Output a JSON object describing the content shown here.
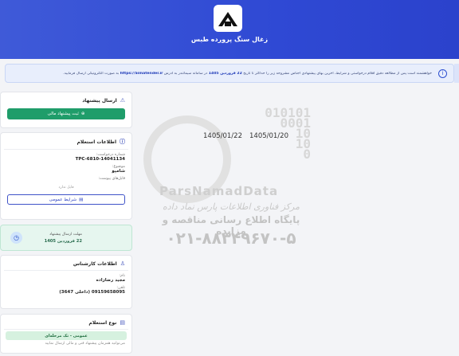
{
  "header": {
    "brand": "زغال سنگ پرورده طبس"
  },
  "notice": {
    "prefix": "خواهشمند است پس از مطالعه دقیق اقلام درخواستی و شرایط، آخرین بهای پیشنهادی اجناس مشروحه زیر را حداکثر تا تاریخ",
    "deadline": "22 فروردین 1405",
    "middle": "در سامانه سیماتندر به آدرس",
    "site": "https://Simatender.ir",
    "suffix": "به صورت الکترونیکی ارسال فرمایید."
  },
  "dates": {
    "start": "1405/01/20",
    "end": "1405/01/22"
  },
  "watermark": {
    "digits": [
      "010101",
      "0001",
      "10",
      "10",
      "0"
    ],
    "name": "ParsNamadData",
    "line1": "مرکز فناوری اطلاعات پارس نماد داده",
    "line2": "پایگاه اطلاع رسانی مناقصه و مزایده",
    "phone": "۰۲۱-۸۸۳۴۹۶۷۰-۵"
  },
  "send": {
    "title": "ارسال پیشنهاد",
    "button": "ثبت پیشنهاد مالی"
  },
  "inquiry": {
    "title": "اطلاعات استعلام",
    "number_label": "شماره درخواست:",
    "number": "TPC-6810-14041134",
    "subject_label": "موضوع:",
    "subject": "شامپو",
    "files_label": "فایل‌های پیوست:",
    "no_file": "فایل ندارد",
    "terms_button": "شرایط عمومی"
  },
  "deadline": {
    "label": "مهلت ارسال پیشنهاد",
    "value": "22 فروردین 1405"
  },
  "expert": {
    "title": "اطلاعات کارشناس",
    "name_label": "نام:",
    "name": "مجید رضازاده",
    "phone_label": "تلفن:",
    "phone": "09159658095 (داخلی 3647)"
  },
  "type": {
    "title": "نوع استعلام",
    "badge": "عمومی - تک مرحله‌ای",
    "desc": "می‌توانید همزمان پیشنهاد فنی و مالی ارسال نمایید"
  },
  "colors": {
    "header": "#2f49d4",
    "accent_green": "#1f9d6a",
    "deadline_bg": "#e6f6ef"
  }
}
